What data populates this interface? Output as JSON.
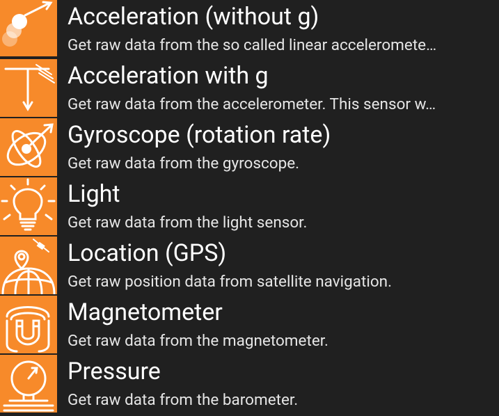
{
  "sensors": [
    {
      "title": "Acceleration (without g)",
      "description": "Get raw data from the so called linear acceleromete…",
      "icon": "linear-acceleration-icon"
    },
    {
      "title": "Acceleration with g",
      "description": "Get raw data from the accelerometer. This sensor w…",
      "icon": "gravity-acceleration-icon"
    },
    {
      "title": "Gyroscope (rotation rate)",
      "description": "Get raw data from the gyroscope.",
      "icon": "gyroscope-icon"
    },
    {
      "title": "Light",
      "description": "Get raw data from the light sensor.",
      "icon": "light-bulb-icon"
    },
    {
      "title": "Location (GPS)",
      "description": "Get raw position data from satellite navigation.",
      "icon": "location-globe-icon"
    },
    {
      "title": "Magnetometer",
      "description": "Get raw data from the magnetometer.",
      "icon": "magnet-icon"
    },
    {
      "title": "Pressure",
      "description": "Get raw data from the barometer.",
      "icon": "barometer-gauge-icon"
    }
  ],
  "colors": {
    "background": "#202020",
    "icon_tile": "#f78a2a",
    "title_text": "#ffffff",
    "description_text": "#e6e6e6"
  }
}
